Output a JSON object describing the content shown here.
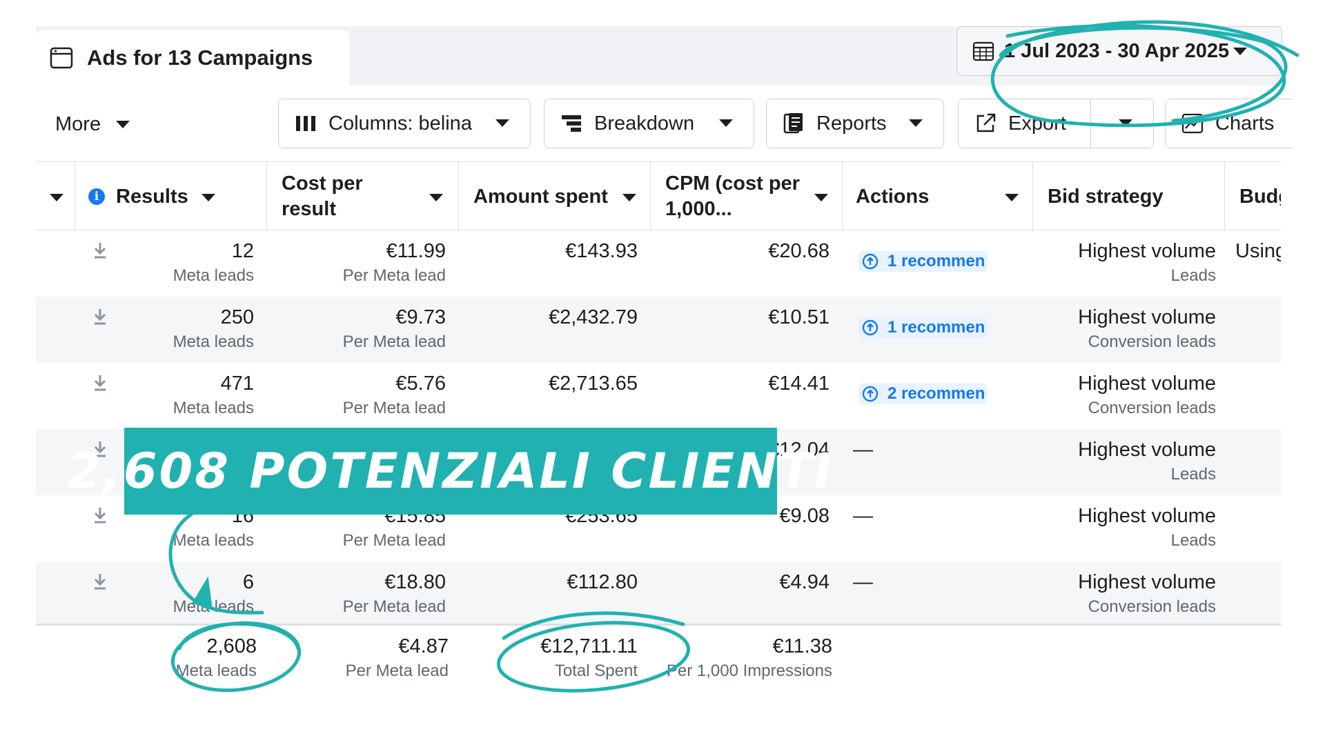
{
  "header": {
    "title": "Ads for 13 Campaigns",
    "date_range": "1 Jul 2023 - 30 Apr 2025"
  },
  "toolbar": {
    "more": "More",
    "columns": "Columns: belina",
    "breakdown": "Breakdown",
    "reports": "Reports",
    "export": "Export",
    "charts": "Charts"
  },
  "columns": {
    "results": "Results",
    "cost_per_result": "Cost per result",
    "amount_spent": "Amount spent",
    "cpm": "CPM (cost per 1,000...",
    "actions": "Actions",
    "bid_strategy": "Bid strategy",
    "budget": "Budget"
  },
  "rows": [
    {
      "results": "12",
      "results_sub": "Meta leads",
      "cpr": "€11.99",
      "cpr_sub": "Per Meta lead",
      "spent": "€143.93",
      "cpm": "€20.68",
      "action": "1 recommen",
      "bid": "Highest volume",
      "bid_sub": "Leads",
      "budget": "Using ca"
    },
    {
      "results": "250",
      "results_sub": "Meta leads",
      "cpr": "€9.73",
      "cpr_sub": "Per Meta lead",
      "spent": "€2,432.79",
      "cpm": "€10.51",
      "action": "1 recommen",
      "bid": "Highest volume",
      "bid_sub": "Conversion leads",
      "budget": ""
    },
    {
      "results": "471",
      "results_sub": "Meta leads",
      "cpr": "€5.76",
      "cpr_sub": "Per Meta lead",
      "spent": "€2,713.65",
      "cpm": "€14.41",
      "action": "2 recommen",
      "bid": "Highest volume",
      "bid_sub": "Conversion leads",
      "budget": ""
    },
    {
      "results": "",
      "results_sub": "",
      "cpr": "",
      "cpr_sub": "",
      "spent": "",
      "cpm": "€12.04",
      "action": "—",
      "bid": "Highest volume",
      "bid_sub": "Leads",
      "budget": ""
    },
    {
      "results": "16",
      "results_sub": "Meta leads",
      "cpr": "€15.85",
      "cpr_sub": "Per Meta lead",
      "spent": "€253.65",
      "cpm": "€9.08",
      "action": "—",
      "bid": "Highest volume",
      "bid_sub": "Leads",
      "budget": ""
    },
    {
      "results": "6",
      "results_sub": "Meta leads",
      "cpr": "€18.80",
      "cpr_sub": "Per Meta lead",
      "spent": "€112.80",
      "cpm": "€4.94",
      "action": "—",
      "bid": "Highest volume",
      "bid_sub": "Conversion leads",
      "budget": ""
    }
  ],
  "totals": {
    "results": "2,608",
    "results_sub": "Meta leads",
    "cpr": "€4.87",
    "cpr_sub": "Per Meta lead",
    "spent": "€12,711.11",
    "spent_sub": "Total Spent",
    "cpm": "€11.38",
    "cpm_sub": "Per 1,000 Impressions"
  },
  "overlay": {
    "banner_text": "2,608 potenziali clienti",
    "accent_color": "#21b1b1"
  }
}
